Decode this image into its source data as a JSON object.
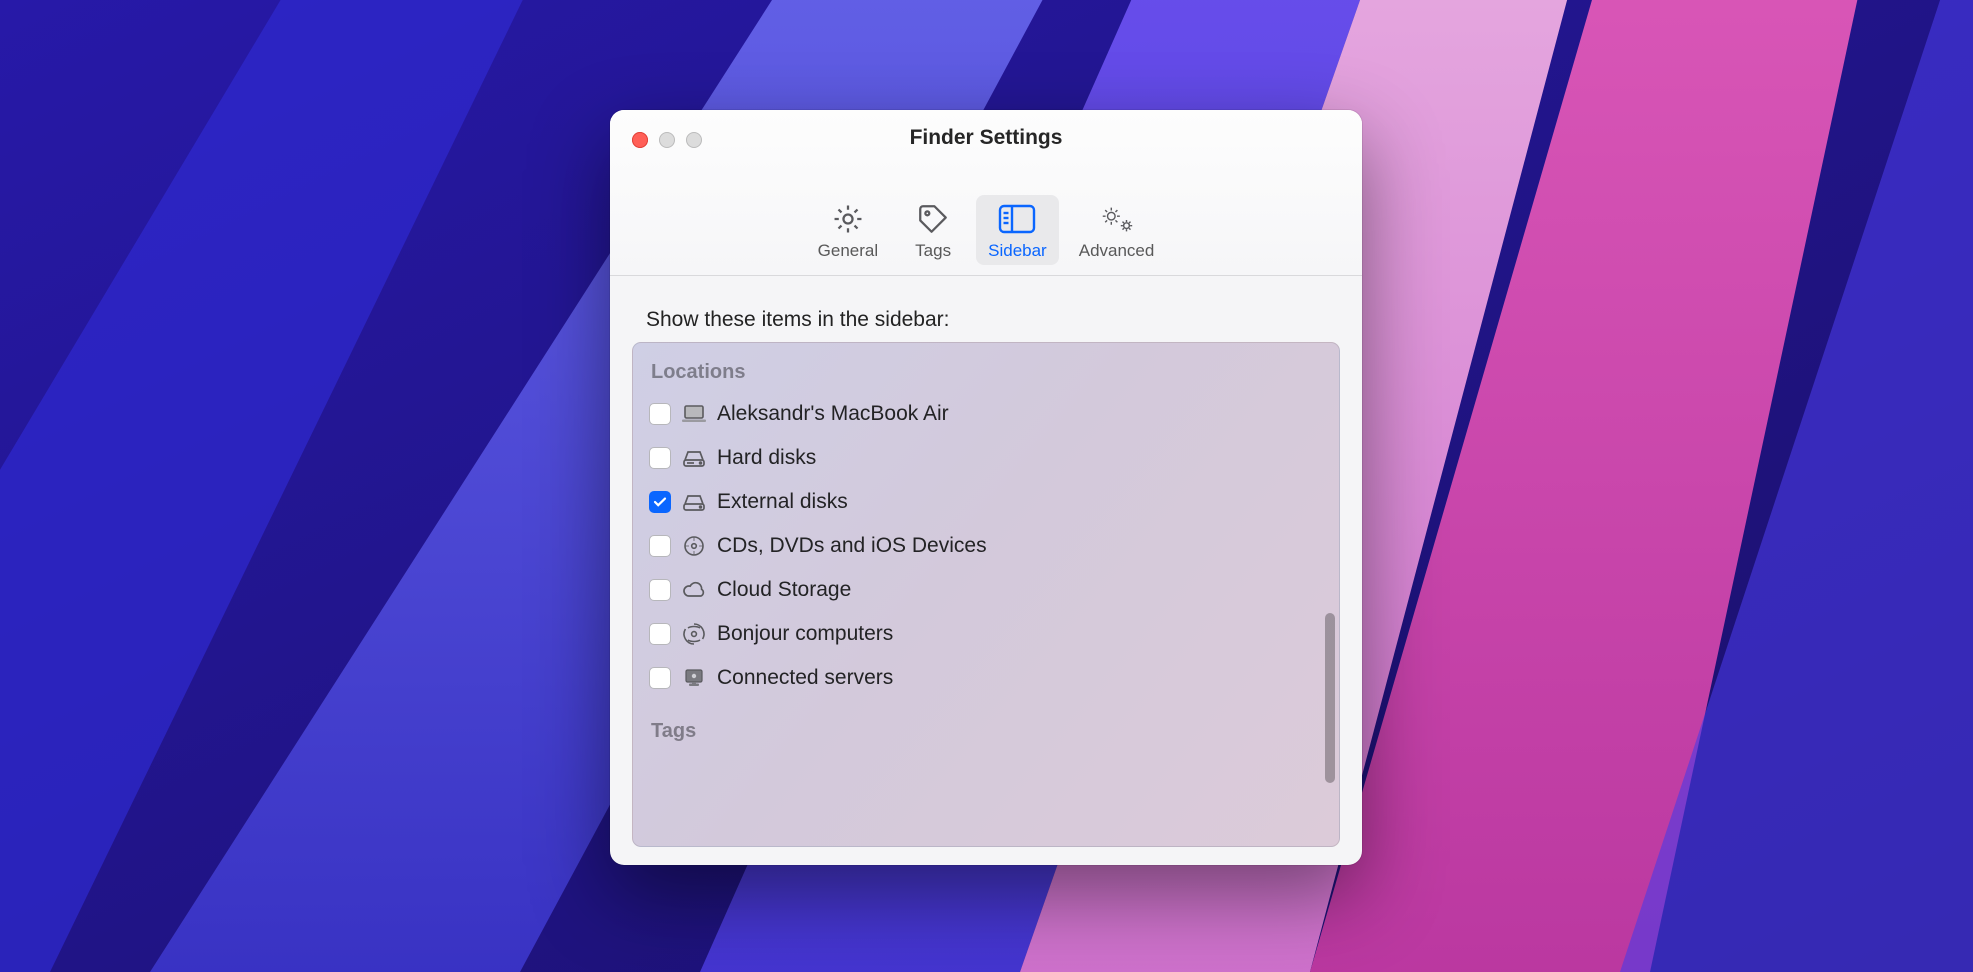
{
  "window": {
    "title": "Finder Settings"
  },
  "toolbar": {
    "general": "General",
    "tags": "Tags",
    "sidebar": "Sidebar",
    "advanced": "Advanced",
    "active": "sidebar"
  },
  "content": {
    "heading": "Show these items in the sidebar:",
    "sections": {
      "locations": {
        "label": "Locations",
        "items": [
          {
            "icon": "laptop-icon",
            "label": "Aleksandr's MacBook Air",
            "checked": false
          },
          {
            "icon": "disk-icon",
            "label": "Hard disks",
            "checked": false
          },
          {
            "icon": "disk-icon",
            "label": "External disks",
            "checked": true
          },
          {
            "icon": "disc-icon",
            "label": "CDs, DVDs and iOS Devices",
            "checked": false
          },
          {
            "icon": "cloud-icon",
            "label": "Cloud Storage",
            "checked": false
          },
          {
            "icon": "bonjour-icon",
            "label": "Bonjour computers",
            "checked": false
          },
          {
            "icon": "server-icon",
            "label": "Connected servers",
            "checked": false
          }
        ]
      },
      "tags": {
        "label": "Tags"
      }
    }
  }
}
